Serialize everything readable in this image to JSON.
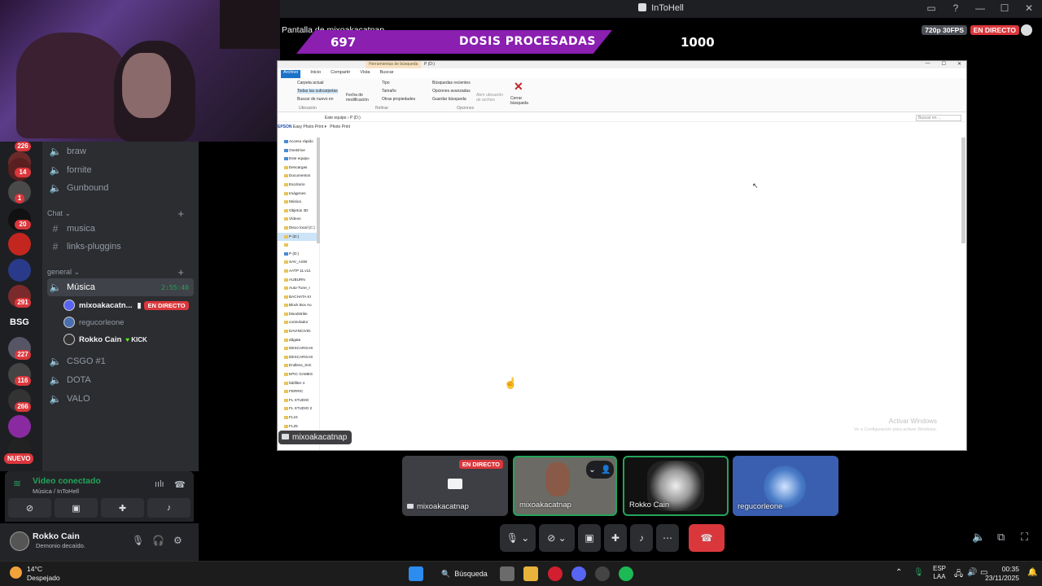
{
  "window": {
    "title": "InToHell"
  },
  "stream": {
    "title": "Pantalla de mixoakacatnap",
    "quality": "720p 30FPS",
    "live_label": "EN DIRECTO",
    "overlay": {
      "current": "697",
      "label": "DOSIS PROCESADAS",
      "goal": "1000"
    },
    "owner_tag": "mixoakacatnap"
  },
  "servers": {
    "badges": [
      "226",
      "14",
      "1",
      "20",
      "291",
      "227",
      "116",
      "266"
    ],
    "text_server": "BSG",
    "new_label": "NUEVO"
  },
  "channels": {
    "top": [
      "braw",
      "fornite",
      "Gunbound"
    ],
    "chat_category": "Chat",
    "chat_channels": [
      "musica",
      "links-pluggins"
    ],
    "general_category": "general",
    "active_voice": {
      "name": "Música",
      "time": "2:55:40"
    },
    "voice_users": [
      {
        "name": "mixoakacatn...",
        "live": "EN DIRECTO"
      },
      {
        "name": "regucorleone"
      },
      {
        "name": "Rokko Cain",
        "badge": "KICK"
      }
    ],
    "others": [
      "CSGO #1",
      "DOTA",
      "VALO"
    ]
  },
  "voice_panel": {
    "status": "Video conectado",
    "location": "Música / InToHell"
  },
  "user_panel": {
    "name": "Rokko Cain",
    "status": "Demonio decaído."
  },
  "explorer": {
    "context_tab": "Herramientas de búsqueda",
    "context_path": "P (D:)",
    "tabs": [
      "Archivo",
      "Inicio",
      "Compartir",
      "Vista",
      "Buscar"
    ],
    "ribbon": {
      "scope": [
        "Carpeta actual",
        "Todas las subcarpetas",
        "Buscar de nuevo en"
      ],
      "scope_group": "Ubicación",
      "modified": "Fecha de modificación",
      "refine": [
        "Tipo",
        "Tamaño",
        "Otras propiedades"
      ],
      "refine_group": "Refinar",
      "options": [
        "Búsquedas recientes",
        "Opciones avanzadas",
        "Guardar búsqueda"
      ],
      "options_group": "Opciones",
      "open_location": "Abrir ubicación de archivo",
      "close": "Cerrar búsqueda"
    },
    "address": "Este equipo  ›  P (D:)",
    "search_placeholder": "Buscar en ...",
    "epson": [
      "Easy Photo Print",
      "Photo Print"
    ],
    "tree": [
      "Acceso rápido",
      "OneDrive",
      "Este equipo",
      "Descargas",
      "Documentos",
      "Escritorio",
      "Imágenes",
      "Música",
      "Objetos 3D",
      "Vídeos",
      "Disco local (C:)",
      "P (D:)",
      "",
      "P (D:)",
      "SAV_ASW",
      "AATP 11.v11",
      "AUBURN",
      "Auto-Tune_I",
      "BACHATA KI",
      "Block Box Au",
      "bloodstrike",
      "controlador",
      "DAVINCIVID",
      "ddgate",
      "DESCARGAS",
      "DESCARGAS",
      "Endless_Smi",
      "EPIC GAMES",
      "fabfilter 4",
      "FERRIC",
      "FL STUDIO",
      "FL STUDIO 2",
      "FL24",
      "FL25"
    ],
    "watermark_title": "Activar Windows",
    "watermark_sub": "Ve a Configuración para activar Windows."
  },
  "tiles": [
    {
      "name": "mixoakacatnap",
      "live": "EN DIRECTO"
    },
    {
      "name": "mixoakacatnap"
    },
    {
      "name": "Rokko Cain"
    },
    {
      "name": "regucorleone"
    }
  ],
  "taskbar": {
    "temp": "14°C",
    "weather": "Despejado",
    "search": "Búsqueda",
    "lang1": "ESP",
    "lang2": "LAA",
    "time": "00:35",
    "date": "23/11/2025"
  }
}
